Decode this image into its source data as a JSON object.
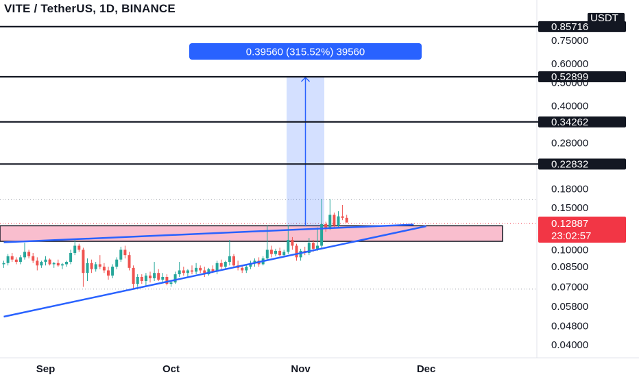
{
  "header": {
    "title": "VITE / TetherUS, 1D, BINANCE"
  },
  "chart_data": {
    "type": "candlestick",
    "symbol": "VITE / TetherUS",
    "interval": "1D",
    "exchange": "BINANCE",
    "scale": "log",
    "y_ticks": [
      0.04,
      0.048,
      0.058,
      0.07,
      0.085,
      0.1,
      0.15,
      0.18,
      0.28,
      0.4,
      0.5,
      0.6,
      0.75
    ],
    "y_tick_labels": [
      "0.04000",
      "0.04800",
      "0.05800",
      "0.07000",
      "0.08500",
      "0.10000",
      "0.15000",
      "0.18000",
      "0.28000",
      "0.40000",
      "0.50000",
      "0.60000",
      "0.75000"
    ],
    "x_ticks": [
      "Sep",
      "Oct",
      "Nov",
      "Dec"
    ],
    "horizontal_levels": [
      {
        "label": "0.85716",
        "value": 0.85716
      },
      {
        "label": "0.52899",
        "value": 0.52899
      },
      {
        "label": "0.34262",
        "value": 0.34262
      },
      {
        "label": "0.22832",
        "value": 0.22832
      }
    ],
    "currency_label": "USDT",
    "current_price": {
      "label": "0.12887",
      "value": 0.12887,
      "countdown": "23:02:57",
      "color": "#f23645"
    },
    "dotted_levels": [
      0.162,
      0.0685
    ],
    "measurement": {
      "label": "0.39560 (315.52%) 39560",
      "from": 0.1254,
      "to": 0.52899,
      "color": "#2962ff"
    },
    "support_zone": {
      "from": 0.1085,
      "to": 0.126,
      "color": "#f7a8bd"
    },
    "trendlines": [
      {
        "name": "upper",
        "from": [
          0,
          0.1075
        ],
        "to": [
          98,
          0.1275
        ]
      },
      {
        "name": "lower",
        "from": [
          0,
          0.0525
        ],
        "to": [
          101,
          0.1255
        ]
      }
    ],
    "day_index": {
      "start": "2021-08-22",
      "Sep": 10,
      "Oct": 40,
      "Nov": 71,
      "Dec": 101,
      "last": 82
    },
    "candles": [
      [
        0.087,
        0.09,
        0.084,
        0.088
      ],
      [
        0.088,
        0.096,
        0.086,
        0.094
      ],
      [
        0.094,
        0.097,
        0.089,
        0.091
      ],
      [
        0.091,
        0.093,
        0.087,
        0.089
      ],
      [
        0.089,
        0.095,
        0.087,
        0.093
      ],
      [
        0.093,
        0.107,
        0.091,
        0.098
      ],
      [
        0.098,
        0.1,
        0.092,
        0.094
      ],
      [
        0.094,
        0.097,
        0.088,
        0.09
      ],
      [
        0.09,
        0.093,
        0.082,
        0.086
      ],
      [
        0.086,
        0.09,
        0.084,
        0.089
      ],
      [
        0.089,
        0.094,
        0.086,
        0.091
      ],
      [
        0.091,
        0.092,
        0.086,
        0.087
      ],
      [
        0.087,
        0.089,
        0.084,
        0.088
      ],
      [
        0.088,
        0.091,
        0.085,
        0.086
      ],
      [
        0.086,
        0.088,
        0.083,
        0.087
      ],
      [
        0.087,
        0.09,
        0.085,
        0.089
      ],
      [
        0.089,
        0.1,
        0.087,
        0.097
      ],
      [
        0.097,
        0.11,
        0.095,
        0.104
      ],
      [
        0.104,
        0.106,
        0.098,
        0.1
      ],
      [
        0.1,
        0.102,
        0.07,
        0.08
      ],
      [
        0.08,
        0.092,
        0.074,
        0.088
      ],
      [
        0.088,
        0.091,
        0.08,
        0.083
      ],
      [
        0.083,
        0.089,
        0.081,
        0.087
      ],
      [
        0.087,
        0.095,
        0.083,
        0.085
      ],
      [
        0.085,
        0.088,
        0.08,
        0.082
      ],
      [
        0.082,
        0.085,
        0.075,
        0.078
      ],
      [
        0.078,
        0.087,
        0.076,
        0.085
      ],
      [
        0.085,
        0.093,
        0.083,
        0.091
      ],
      [
        0.091,
        0.103,
        0.089,
        0.1
      ],
      [
        0.1,
        0.104,
        0.092,
        0.095
      ],
      [
        0.095,
        0.098,
        0.082,
        0.084
      ],
      [
        0.084,
        0.086,
        0.069,
        0.072
      ],
      [
        0.072,
        0.079,
        0.07,
        0.077
      ],
      [
        0.077,
        0.079,
        0.072,
        0.074
      ],
      [
        0.074,
        0.08,
        0.07,
        0.078
      ],
      [
        0.078,
        0.081,
        0.073,
        0.076
      ],
      [
        0.076,
        0.089,
        0.074,
        0.08
      ],
      [
        0.08,
        0.083,
        0.074,
        0.075
      ],
      [
        0.075,
        0.08,
        0.073,
        0.077
      ],
      [
        0.077,
        0.079,
        0.071,
        0.072
      ],
      [
        0.072,
        0.074,
        0.07,
        0.073
      ],
      [
        0.073,
        0.081,
        0.072,
        0.079
      ],
      [
        0.079,
        0.089,
        0.077,
        0.082
      ],
      [
        0.082,
        0.085,
        0.078,
        0.08
      ],
      [
        0.08,
        0.083,
        0.077,
        0.082
      ],
      [
        0.082,
        0.086,
        0.079,
        0.081
      ],
      [
        0.081,
        0.088,
        0.079,
        0.084
      ],
      [
        0.084,
        0.086,
        0.08,
        0.082
      ],
      [
        0.082,
        0.085,
        0.077,
        0.079
      ],
      [
        0.079,
        0.084,
        0.078,
        0.083
      ],
      [
        0.083,
        0.086,
        0.08,
        0.081
      ],
      [
        0.081,
        0.09,
        0.079,
        0.088
      ],
      [
        0.088,
        0.091,
        0.083,
        0.085
      ],
      [
        0.085,
        0.09,
        0.083,
        0.089
      ],
      [
        0.089,
        0.11,
        0.086,
        0.094
      ],
      [
        0.094,
        0.096,
        0.084,
        0.086
      ],
      [
        0.086,
        0.09,
        0.082,
        0.084
      ],
      [
        0.084,
        0.086,
        0.08,
        0.082
      ],
      [
        0.082,
        0.086,
        0.08,
        0.085
      ],
      [
        0.085,
        0.09,
        0.083,
        0.088
      ],
      [
        0.088,
        0.092,
        0.085,
        0.09
      ],
      [
        0.09,
        0.093,
        0.085,
        0.087
      ],
      [
        0.087,
        0.094,
        0.086,
        0.092
      ],
      [
        0.092,
        0.126,
        0.09,
        0.1
      ],
      [
        0.1,
        0.104,
        0.093,
        0.096
      ],
      [
        0.096,
        0.101,
        0.094,
        0.099
      ],
      [
        0.099,
        0.102,
        0.094,
        0.095
      ],
      [
        0.095,
        0.1,
        0.093,
        0.098
      ],
      [
        0.098,
        0.127,
        0.096,
        0.11
      ],
      [
        0.11,
        0.113,
        0.1,
        0.104
      ],
      [
        0.104,
        0.106,
        0.09,
        0.093
      ],
      [
        0.093,
        0.101,
        0.09,
        0.099
      ],
      [
        0.099,
        0.103,
        0.095,
        0.097
      ],
      [
        0.097,
        0.112,
        0.095,
        0.107
      ],
      [
        0.107,
        0.11,
        0.098,
        0.101
      ],
      [
        0.101,
        0.124,
        0.099,
        0.104
      ],
      [
        0.104,
        0.163,
        0.102,
        0.128
      ],
      [
        0.128,
        0.131,
        0.119,
        0.123
      ],
      [
        0.123,
        0.163,
        0.121,
        0.14
      ],
      [
        0.14,
        0.143,
        0.123,
        0.126
      ],
      [
        0.126,
        0.145,
        0.124,
        0.138
      ],
      [
        0.138,
        0.154,
        0.133,
        0.136
      ],
      [
        0.136,
        0.14,
        0.131,
        0.13
      ]
    ]
  }
}
